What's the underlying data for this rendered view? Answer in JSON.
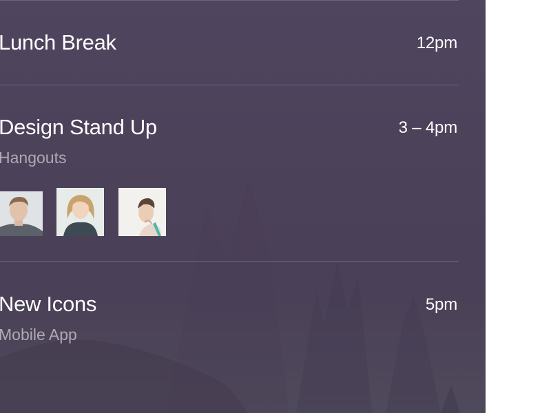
{
  "events": [
    {
      "title": "Lunch Break",
      "time": "12pm",
      "subtitle": ""
    },
    {
      "title": "Design Stand Up",
      "time": "3 – 4pm",
      "subtitle": "Hangouts"
    },
    {
      "title": "New Icons",
      "time": "5pm",
      "subtitle": "Mobile App"
    }
  ],
  "attendees": [
    {
      "name": "attendee-1",
      "icon": "avatar-man"
    },
    {
      "name": "attendee-2",
      "icon": "avatar-woman-blonde"
    },
    {
      "name": "attendee-3",
      "icon": "avatar-woman-dark"
    }
  ],
  "colors": {
    "panel_background": "#4b4159",
    "primary_text": "#ffffff",
    "secondary_text": "#b0aab8"
  }
}
